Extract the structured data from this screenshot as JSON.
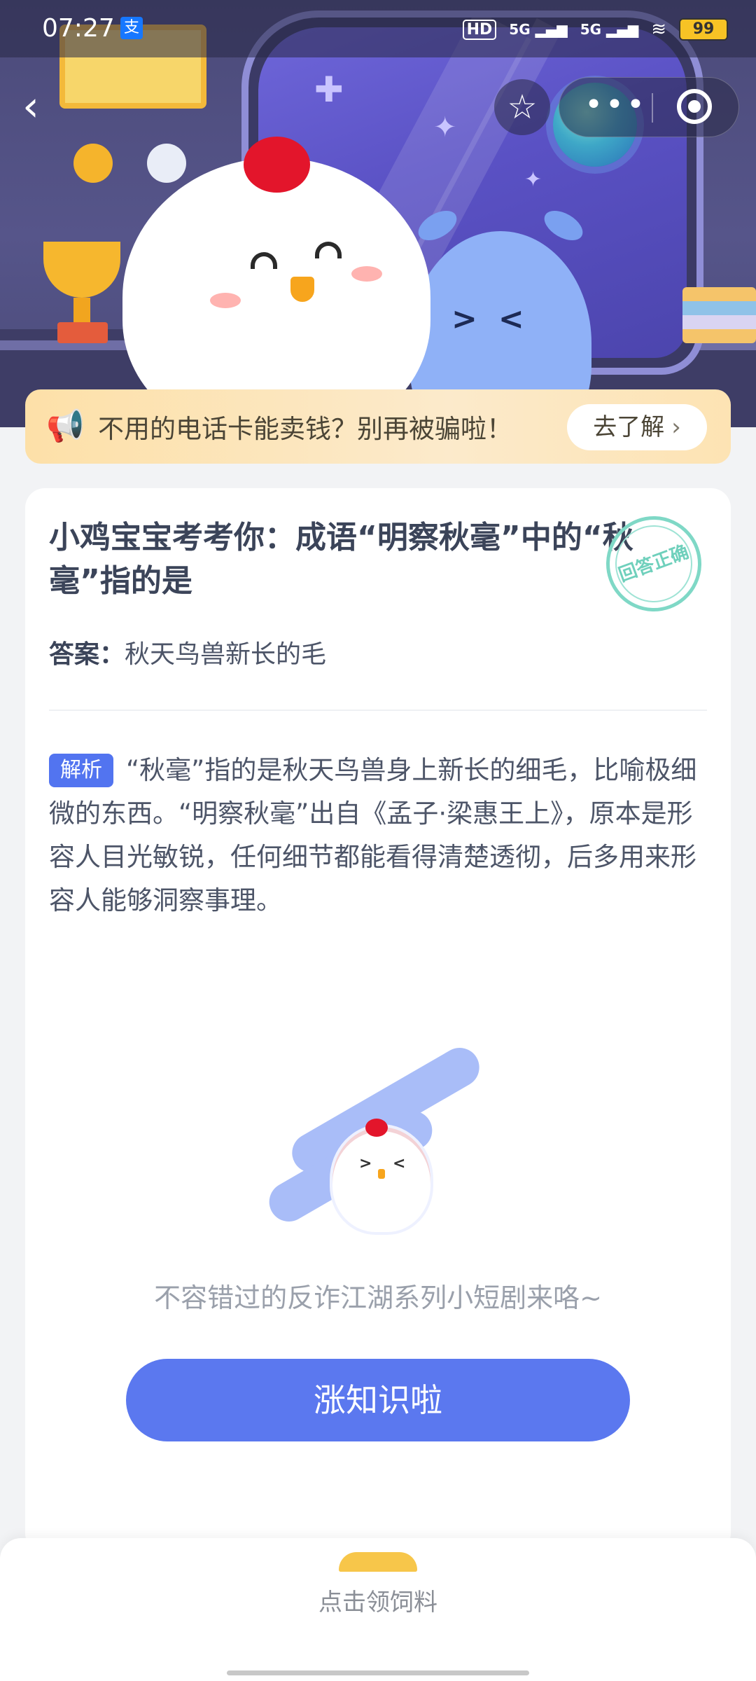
{
  "status_bar": {
    "time": "07:27",
    "app_icon_char": "支",
    "hd_label": "HD",
    "signal_1": "5G",
    "signal_2": "5G",
    "battery": "99"
  },
  "nav": {
    "back_glyph": "‹",
    "favorite_glyph": "☆",
    "more_glyph": "•••"
  },
  "notice": {
    "text": "不用的电话卡能卖钱？别再被骗啦！",
    "button_label": "去了解",
    "button_chevron": "›"
  },
  "quiz": {
    "question": "小鸡宝宝考考你：成语“明察秋毫”中的“秋毫”指的是",
    "stamp_text": "回答正确",
    "answer_label": "答案：",
    "answer_value": "秋天鸟兽新长的毛",
    "analysis_tag": "解析",
    "analysis_text": "“秋毫”指的是秋天鸟兽身上新长的细毛，比喻极细微的东西。“明察秋毫”出自《孟子·梁惠王上》，原本是形容人目光敏锐，任何细节都能看得清楚透彻，后多用来形容人能够洞察事理。"
  },
  "promo": {
    "subtitle": "不容错过的反诈江湖系列小短剧来咯~",
    "cta_label": "涨知识啦"
  },
  "bottom": {
    "feed_label": "点击领饲料"
  },
  "colors": {
    "accent": "#5b78ef",
    "tag": "#5274f0",
    "notice_bg": "#fde0a8",
    "stamp": "#7fd8c6"
  }
}
